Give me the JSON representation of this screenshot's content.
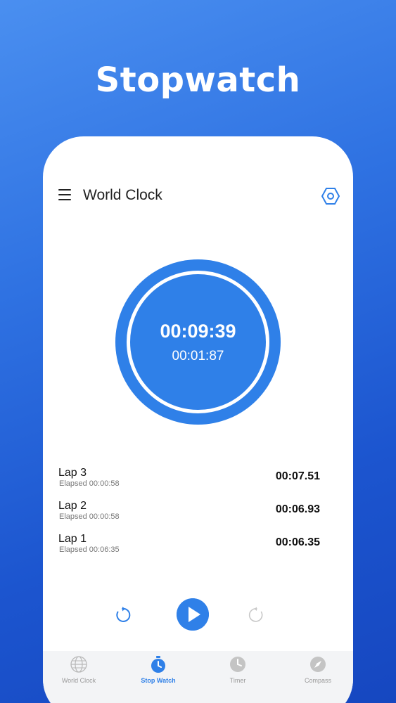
{
  "promo": {
    "title": "Stopwatch"
  },
  "app_bar": {
    "title": "World Clock",
    "menu_icon": "hamburger-menu-icon",
    "settings_icon": "hexagon-settings-icon"
  },
  "stopwatch": {
    "total_time": "00:09:39",
    "current_lap_time": "00:01:87"
  },
  "laps": [
    {
      "name": "Lap 3",
      "elapsed": "Elapsed 00:00:58",
      "time": "00:07.51"
    },
    {
      "name": "Lap 2",
      "elapsed": "Elapsed 00:00:58",
      "time": "00:06.93"
    },
    {
      "name": "Lap 1",
      "elapsed": "Elapsed 00:06:35",
      "time": "00:06.35"
    }
  ],
  "controls": {
    "left_icon": "reset-icon",
    "center_icon": "play-icon",
    "right_icon": "lap-icon"
  },
  "nav": {
    "items": [
      {
        "label": "World Clock",
        "icon": "globe-icon",
        "active": false
      },
      {
        "label": "Stop Watch",
        "icon": "stopwatch-icon",
        "active": true
      },
      {
        "label": "Timer",
        "icon": "clock-icon",
        "active": false
      },
      {
        "label": "Compass",
        "icon": "compass-icon",
        "active": false
      }
    ]
  },
  "colors": {
    "accent": "#2f80e8",
    "background_top": "#4a8ff0",
    "background_bottom": "#1647c0"
  }
}
